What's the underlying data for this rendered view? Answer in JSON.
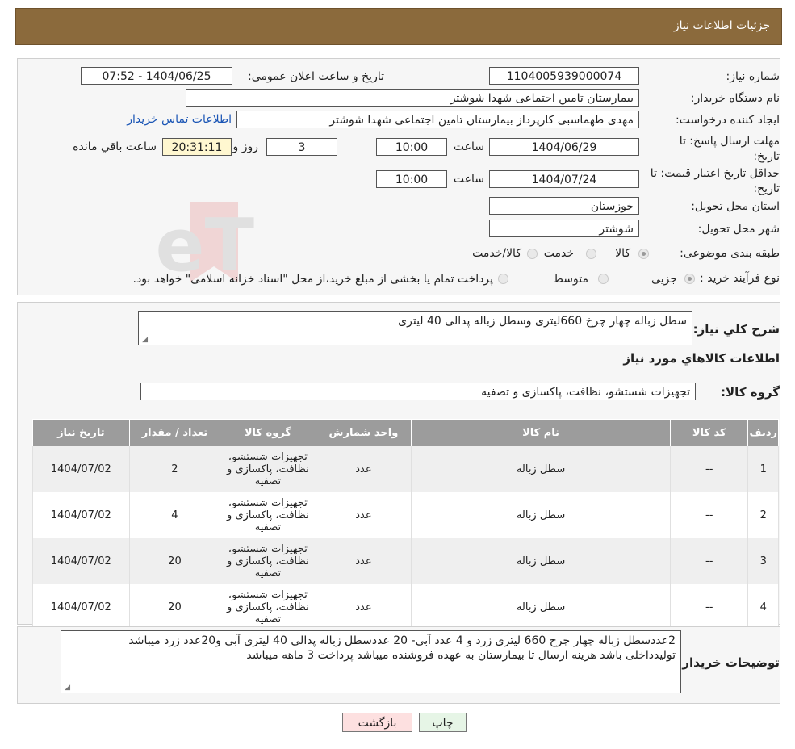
{
  "header": {
    "title": "جزئیات اطلاعات نیاز"
  },
  "watermark": {
    "text": "AriaTender.neT"
  },
  "info": {
    "need_number_label": "شماره نیاز:",
    "need_number": "1104005939000074",
    "announce_label": "تاریخ و ساعت اعلان عمومی:",
    "announce_value": "1404/06/25 - 07:52",
    "buyer_org_label": "نام دستگاه خریدار:",
    "buyer_org": "بیمارستان تامین اجتماعی شهدا شوشتر",
    "creator_label": "ایجاد کننده درخواست:",
    "creator": "مهدی طهماسبی کارپرداز بیمارستان تامین اجتماعی شهدا شوشتر",
    "contact_link": "اطلاعات تماس خریدار",
    "deadline_label": "مهلت ارسال پاسخ: تا تاریخ:",
    "deadline_date": "1404/06/29",
    "time_label": "ساعت",
    "deadline_time": "10:00",
    "days": "3",
    "days_label": "روز و",
    "remaining": "20:31:11",
    "remaining_label": "ساعت باقي مانده",
    "validity_label": "حداقل تاریخ اعتبار قیمت: تا تاریخ:",
    "validity_date": "1404/07/24",
    "validity_time": "10:00",
    "province_label": "استان محل تحویل:",
    "province": "خوزستان",
    "city_label": "شهر محل تحویل:",
    "city": "شوشتر",
    "category_label": "طبقه بندی موضوعی:",
    "category_options": [
      "کالا",
      "خدمت",
      "کالا/خدمت"
    ],
    "process_label": "نوع فرآیند خرید :",
    "process_options": [
      "جزیی",
      "متوسط"
    ],
    "process_note": "پرداخت تمام یا بخشی از مبلغ خرید،از محل \"اسناد خزانه اسلامی\" خواهد بود."
  },
  "description": {
    "label": "شرح کلي نیاز:",
    "text": "سطل زباله چهار چرخ 660لیتری وسطل زباله پدالی 40 لیتری",
    "goods_title": "اطلاعات کالاهاي مورد نیاز",
    "group_label": "گروه کالا:",
    "group_value": "تجهیزات شستشو، نظافت، پاکسازی و تصفیه"
  },
  "table": {
    "headers": [
      "رديف",
      "کد کالا",
      "نام کالا",
      "واحد شمارش",
      "گروه کالا",
      "تعداد / مقدار",
      "تاریخ نیاز"
    ],
    "rows": [
      [
        "1",
        "--",
        "سطل زباله",
        "عدد",
        "تجهیزات شستشو، نظافت، پاکسازی و تصفیه",
        "2",
        "1404/07/02"
      ],
      [
        "2",
        "--",
        "سطل زباله",
        "عدد",
        "تجهیزات شستشو، نظافت، پاکسازی و تصفیه",
        "4",
        "1404/07/02"
      ],
      [
        "3",
        "--",
        "سطل زباله",
        "عدد",
        "تجهیزات شستشو، نظافت، پاکسازی و تصفیه",
        "20",
        "1404/07/02"
      ],
      [
        "4",
        "--",
        "سطل زباله",
        "عدد",
        "تجهیزات شستشو، نظافت، پاکسازی و تصفیه",
        "20",
        "1404/07/02"
      ]
    ]
  },
  "buyer_notes": {
    "label": "توضیحات خریدار:",
    "line1": "2عددسطل زباله چهار چرخ 660 لیتری زرد و 4 عدد آبی- 20 عددسطل زباله پدالی 40 لیتری آبی و20عدد زرد میباشد",
    "line2": "تولیدداخلی باشد هزینه ارسال تا بیمارستان به عهده فروشنده میباشد پرداخت 3 ماهه میباشد"
  },
  "buttons": {
    "print": "چاپ",
    "back": "بازگشت"
  },
  "colors": {
    "header": "#8b6a3c",
    "table_header": "#9c9c9c",
    "back_button": "#fde0e0",
    "print_button": "#e6f5e6"
  }
}
